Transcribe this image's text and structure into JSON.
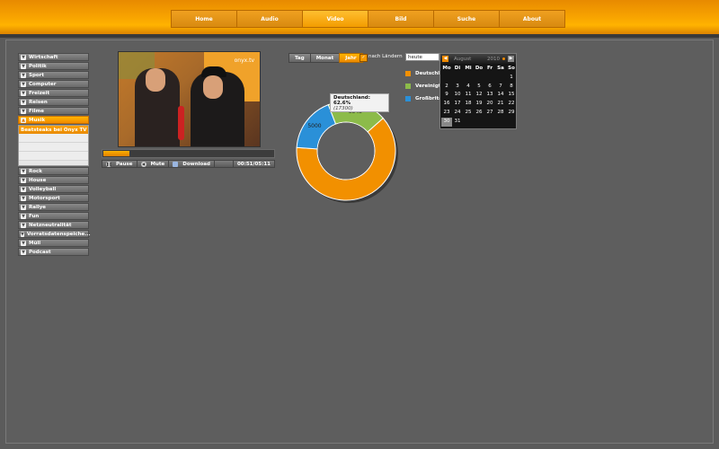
{
  "nav": {
    "items": [
      {
        "label": "Home",
        "active": false
      },
      {
        "label": "Audio",
        "active": false
      },
      {
        "label": "Video",
        "active": true
      },
      {
        "label": "Bild",
        "active": false
      },
      {
        "label": "Suche",
        "active": false
      },
      {
        "label": "About",
        "active": false
      }
    ]
  },
  "sidebar": {
    "items_top": [
      "Wirtschaft",
      "Politik",
      "Sport",
      "Computer",
      "Freizeit",
      "Reisen",
      "Filme"
    ],
    "active": "Musik",
    "sub_items": [
      "Beatsteaks bei Onyx TV"
    ],
    "items_bottom": [
      "Rock",
      "House",
      "Volleyball",
      "Motorsport",
      "Rallye",
      "Fun",
      "Netzneutralität",
      "Vorratsdatenspeiche...",
      "Müll",
      "Podcast"
    ]
  },
  "video": {
    "watermark": "onyx.tv",
    "progress": 0.15,
    "pause_label": "Pause",
    "mute_label": "Mute",
    "download_label": "Download",
    "time": "00:51/05:11"
  },
  "chart_toolbar": {
    "periods": [
      {
        "label": "Tag",
        "active": false
      },
      {
        "label": "Monat",
        "active": false
      },
      {
        "label": "Jahr",
        "active": true
      }
    ],
    "checkbox_label": "nach Ländern",
    "checkbox_checked": true,
    "date_value": "heute"
  },
  "calendar": {
    "month": "August",
    "year": "2010",
    "weekdays": [
      "Mo",
      "Di",
      "Mi",
      "Do",
      "Fr",
      "Sa",
      "So"
    ],
    "weeks": [
      [
        "",
        "",
        "",
        "",
        "",
        "",
        "1"
      ],
      [
        "2",
        "3",
        "4",
        "5",
        "6",
        "7",
        "8"
      ],
      [
        "9",
        "10",
        "11",
        "12",
        "13",
        "14",
        "15"
      ],
      [
        "16",
        "17",
        "18",
        "19",
        "20",
        "21",
        "22"
      ],
      [
        "23",
        "24",
        "25",
        "26",
        "27",
        "28",
        "29"
      ],
      [
        "30",
        "31",
        "",
        "",
        "",
        "",
        ""
      ]
    ],
    "selected": "30"
  },
  "tooltip": {
    "title": "Deutschland:  62.6%",
    "value": "(17300)"
  },
  "chart_data": {
    "type": "pie",
    "donut": true,
    "title": "",
    "series": [
      {
        "name": "Deutschland",
        "value": 17300,
        "color": "#f29000",
        "label": "17300"
      },
      {
        "name": "Vereinigte Staaten",
        "value": 5000,
        "color": "#2a90d8",
        "label": "5000"
      },
      {
        "name": "Großbritannien",
        "value": 5343,
        "color": "#8cbb4a",
        "label": "5343"
      }
    ],
    "legend": [
      "Deutschland",
      "Vereinigte Staaten",
      "Großbritannien"
    ],
    "legend_visible": [
      "Deutschla",
      "Vereinigte",
      "Großbrita"
    ],
    "legend_position": "right"
  }
}
